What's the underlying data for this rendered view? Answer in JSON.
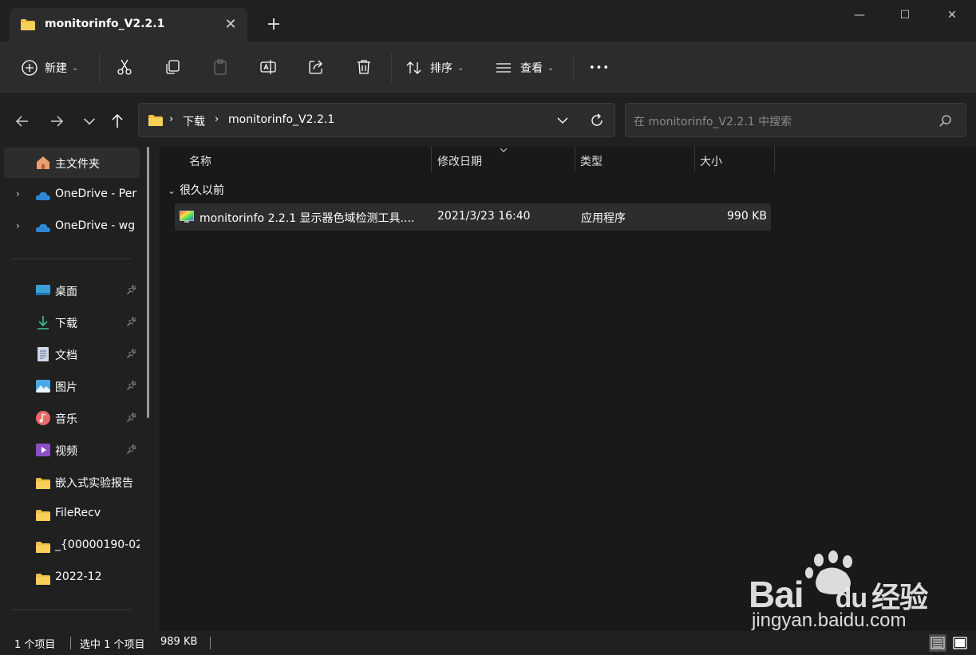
{
  "window": {
    "tab_title": "monitorinfo_V2.2.1",
    "tab_close": "✕",
    "tab_add": "+",
    "minimize": "—",
    "maximize": "☐",
    "close": "✕"
  },
  "toolbar": {
    "new_label": "新建",
    "sort_label": "排序",
    "view_label": "查看",
    "more_label": "•••"
  },
  "address": {
    "crumbs": [
      "下载",
      "monitorinfo_V2.2.1"
    ],
    "search_placeholder": "在 monitorinfo_V2.2.1 中搜索"
  },
  "sidebar": {
    "items": [
      {
        "label": "主文件夹",
        "icon": "home-icon"
      },
      {
        "label": "OneDrive - Per",
        "icon": "onedrive-icon"
      },
      {
        "label": "OneDrive - wg",
        "icon": "onedrive-icon"
      },
      {
        "label": "桌面",
        "icon": "desktop-icon",
        "pinned": true
      },
      {
        "label": "下载",
        "icon": "download-icon",
        "pinned": true
      },
      {
        "label": "文档",
        "icon": "document-icon",
        "pinned": true
      },
      {
        "label": "图片",
        "icon": "picture-icon",
        "pinned": true
      },
      {
        "label": "音乐",
        "icon": "music-icon",
        "pinned": true
      },
      {
        "label": "视频",
        "icon": "video-icon",
        "pinned": true
      },
      {
        "label": "嵌入式实验报告",
        "icon": "folder-icon"
      },
      {
        "label": "FileRecv",
        "icon": "folder-icon"
      },
      {
        "label": "_{00000190-02",
        "icon": "folder-icon"
      },
      {
        "label": "2022-12",
        "icon": "folder-icon"
      }
    ]
  },
  "main": {
    "columns": [
      "名称",
      "修改日期",
      "类型",
      "大小"
    ],
    "group_label": "很久以前",
    "rows": [
      {
        "name": "monitorinfo 2.2.1 显示器色域检测工具....",
        "date": "2021/3/23 16:40",
        "type": "应用程序",
        "size": "990 KB"
      }
    ]
  },
  "status": {
    "count": "1 个项目",
    "selected": "选中 1 个项目",
    "size": "989 KB"
  },
  "watermark": {
    "brand_a": "Bai",
    "brand_b": "du",
    "brand_cn": "经验",
    "url": "jingyan.baidu.com"
  },
  "colors": {
    "background": "#202020",
    "content_bg": "#191919",
    "folder": "#f0c040",
    "onedrive": "#2b88d8",
    "selected_row": "#2d2d2d"
  }
}
